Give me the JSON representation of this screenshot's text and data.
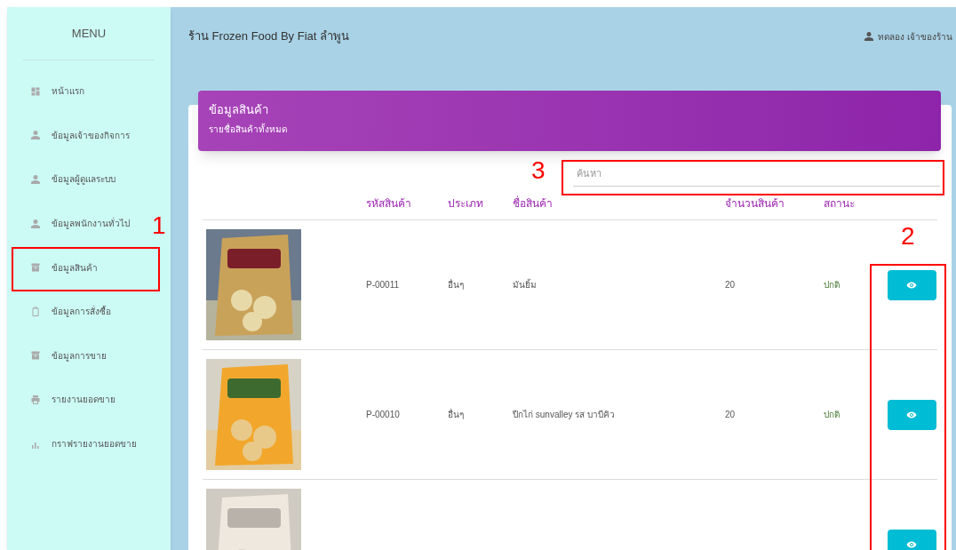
{
  "sidebar": {
    "title": "MENU",
    "items": [
      {
        "label": "หน้าแรก",
        "kind": "dashboard",
        "selected": false
      },
      {
        "label": "ข้อมูลเจ้าของกิจการ",
        "kind": "person",
        "selected": false
      },
      {
        "label": "ข้อมูลผู้ดูแลระบบ",
        "kind": "person",
        "selected": false
      },
      {
        "label": "ข้อมูลพนักงานทั่วไป",
        "kind": "person",
        "selected": false
      },
      {
        "label": "ข้อมูลสินค้า",
        "kind": "archive",
        "selected": false
      },
      {
        "label": "ข้อมูลการสั่งซื้อ",
        "kind": "clipboard",
        "selected": false
      },
      {
        "label": "ข้อมูลการขาย",
        "kind": "archive",
        "selected": false
      },
      {
        "label": "รายงานยอดขาย",
        "kind": "printer",
        "selected": false
      },
      {
        "label": "กราฟรายงานยอดขาย",
        "kind": "chart",
        "selected": false
      }
    ]
  },
  "header": {
    "title": "ร้าน Frozen Food By Fiat ลำพูน",
    "user": "ทดลอง เจ้าของร้าน"
  },
  "card": {
    "title": "ข้อมูลสินค้า",
    "subtitle": "รายชื่อสินค้าทั้งหมด"
  },
  "search": {
    "placeholder": "ค้นหา"
  },
  "table": {
    "columns": [
      "รหัสสินค้า",
      "ประเภท",
      "ชื่อสินค้า",
      "จำนวนสินค้า",
      "สถานะ"
    ],
    "rows": [
      {
        "picture": {
          "kind": "picture"
        },
        "cells": [
          "P-00011",
          "อื่นๆ",
          "มันยิ้ม",
          "20",
          "ปกติ"
        ]
      },
      {
        "picture": {
          "kind": "picture"
        },
        "cells": [
          "P-00010",
          "อื่นๆ",
          "ปีกไก่ sunvalley รส บาบีคิว",
          "20",
          "ปกติ"
        ]
      },
      {
        "picture": {
          "kind": "picture"
        }
      }
    ]
  },
  "annotations": [
    {
      "label": "1"
    },
    {
      "label": "2"
    },
    {
      "label": "3"
    }
  ]
}
